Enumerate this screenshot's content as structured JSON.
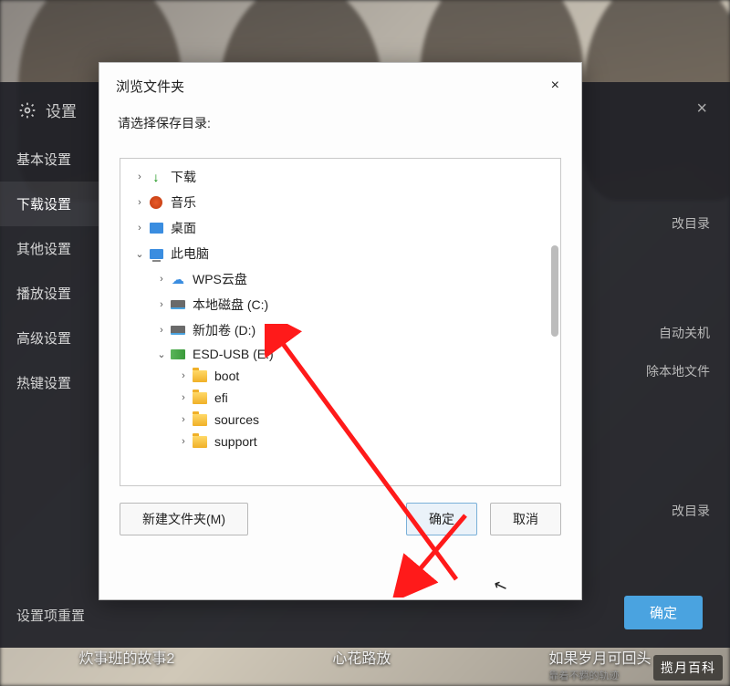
{
  "settings": {
    "title": "设置",
    "close": "×",
    "sidebar": [
      {
        "label": "基本设置",
        "active": false
      },
      {
        "label": "下载设置",
        "active": true
      },
      {
        "label": "其他设置",
        "active": false
      },
      {
        "label": "播放设置",
        "active": false
      },
      {
        "label": "高级设置",
        "active": false
      },
      {
        "label": "热键设置",
        "active": false
      }
    ],
    "reset": "设置项重置",
    "confirm": "确定",
    "right_fragments": {
      "a": "改目录",
      "b": "自动关机",
      "c": "除本地文件",
      "d": "改目录"
    }
  },
  "dialog": {
    "title": "浏览文件夹",
    "close": "×",
    "prompt": "请选择保存目录:",
    "tree": {
      "downloads": "下载",
      "music": "音乐",
      "desktop": "桌面",
      "thispc": "此电脑",
      "wps": "WPS云盘",
      "localdisk": "本地磁盘 (C:)",
      "newvolume": "新加卷 (D:)",
      "esdusb": "ESD-USB (E:)",
      "boot": "boot",
      "efi": "efi",
      "sources": "sources",
      "support": "support"
    },
    "buttons": {
      "newfolder": "新建文件夹(M)",
      "ok": "确定",
      "cancel": "取消"
    }
  },
  "bottom_thumbs": {
    "t1": "炊事班的故事2",
    "t2": "心花路放",
    "t3": "如果岁月可回头",
    "sub3": "靠着不羁的轨迹"
  },
  "watermark": "揽月百科"
}
